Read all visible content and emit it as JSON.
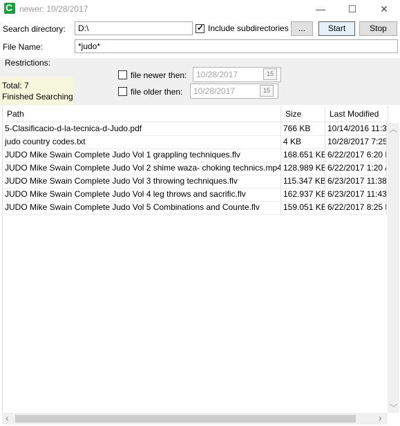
{
  "window": {
    "title": "newer: 10/28/2017",
    "minimize_glyph": "—",
    "maximize_glyph": "☐",
    "close_glyph": "✕"
  },
  "search": {
    "directory_label": "Search directory:",
    "directory_value": "D:\\",
    "include_subdirs_label": "Include subdirectories",
    "include_subdirs_checked": true,
    "browse_label": "...",
    "start_label": "Start",
    "stop_label": "Stop",
    "filename_label": "File Name:",
    "filename_value": "*judo*"
  },
  "restrictions": {
    "label": "Restrictions:",
    "newer_label": "file newer then:",
    "newer_value": "10/28/2017",
    "older_label": "file older then:",
    "older_value": "10/28/2017",
    "calendar_glyph": "15"
  },
  "status": {
    "total": "Total: 7",
    "message": "Finished Searching"
  },
  "table": {
    "columns": [
      "Path",
      "Size",
      "Last Modified"
    ],
    "rows": [
      {
        "path": "5-Clasificacio-d-la-tecnica-d-Judo.pdf",
        "size": "766 KB",
        "modified": "10/14/2016 11:3"
      },
      {
        "path": "judo country codes.txt",
        "size": "4 KB",
        "modified": "10/28/2017 7:25"
      },
      {
        "path": "JUDO Mike Swain Complete Judo Vol 1 grappling techniques.flv",
        "size": "168.651 KB",
        "modified": "6/22/2017 6:20 F"
      },
      {
        "path": "JUDO Mike Swain Complete Judo Vol 2 shime waza- choking technics.mp4",
        "size": "128.989 KB",
        "modified": "6/22/2017 1:20 /"
      },
      {
        "path": "JUDO Mike Swain Complete Judo Vol 3 throwing techniques.flv",
        "size": "115.347 KB",
        "modified": "6/23/2017 11:38"
      },
      {
        "path": "JUDO Mike Swain Complete Judo Vol 4 leg throws and sacrific.flv",
        "size": "162.937 KB",
        "modified": "6/23/2017 11:43"
      },
      {
        "path": "JUDO Mike Swain Complete Judo Vol 5 Combinations and Counte.flv",
        "size": "159.051 KB",
        "modified": "6/22/2017 8:25 F"
      }
    ]
  },
  "scroll": {
    "up_glyph": "︿",
    "down_glyph": "﹀",
    "left_glyph": "‹",
    "right_glyph": "›"
  },
  "colors": {
    "app_icon": "#1a9e3a",
    "status_bg": "#f6f6dc",
    "panel_bg": "#f0f0f0"
  }
}
